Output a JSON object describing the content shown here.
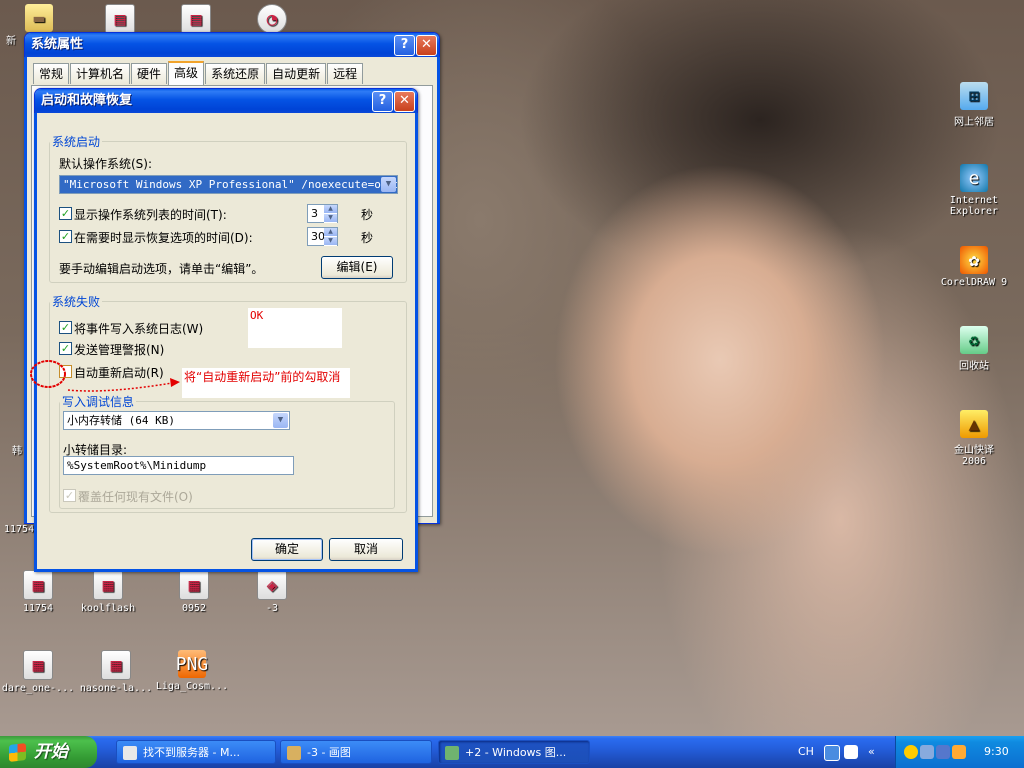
{
  "desktop_icons": [
    {
      "label": "新",
      "icon": "folder-icon"
    },
    {
      "label": "",
      "icon": "document-icon"
    },
    {
      "label": "",
      "icon": "document-icon"
    },
    {
      "label": "",
      "icon": "app-icon"
    },
    {
      "label": "网上邻居",
      "icon": "network-icon"
    },
    {
      "label": "Internet Explorer",
      "icon": "ie-icon"
    },
    {
      "label": "CorelDRAW 9",
      "icon": "corel-icon"
    },
    {
      "label": "回收站",
      "icon": "recycle-bin-icon"
    },
    {
      "label": "金山快译 2006",
      "icon": "kingsoft-icon"
    },
    {
      "label": "11754",
      "icon": "file-icon"
    },
    {
      "label": "koolflash",
      "icon": "file-icon"
    },
    {
      "label": "0952",
      "icon": "file-icon"
    },
    {
      "label": "-3",
      "icon": "image-icon"
    },
    {
      "label": "dare_one-...",
      "icon": "file-icon"
    },
    {
      "label": "nasone-la...",
      "icon": "file-icon"
    },
    {
      "label": "Liga_Cosm...",
      "icon": "png-icon"
    },
    {
      "label": "11754",
      "icon": "text-fragment"
    },
    {
      "label": "韩",
      "icon": "text-fragment"
    }
  ],
  "sysprops": {
    "title": "系统属性",
    "tabs": [
      "常规",
      "计算机名",
      "硬件",
      "高级",
      "系统还原",
      "自动更新",
      "远程"
    ],
    "active_tab": "高级"
  },
  "dialog": {
    "title": "启动和故障恢复",
    "startup": {
      "legend": "系统启动",
      "default_os_label": "默认操作系统(S):",
      "default_os_value": "\"Microsoft Windows XP Professional\" /noexecute=optin",
      "show_list_label": "显示操作系统列表的时间(T):",
      "show_list_value": "3",
      "show_recovery_label": "在需要时显示恢复选项的时间(D):",
      "show_recovery_value": "30",
      "seconds": "秒",
      "edit_hint": "要手动编辑启动选项，请单击“编辑”。",
      "edit_button": "编辑(E)"
    },
    "failure": {
      "legend": "系统失败",
      "write_log": "将事件写入系统日志(W)",
      "send_alert": "发送管理警报(N)",
      "auto_restart": "自动重新启动(R)",
      "debug_info_label": "写入调试信息",
      "dump_type": "小内存转储 (64 KB)",
      "dump_dir_label": "小转储目录:",
      "dump_dir_value": "%SystemRoot%\\Minidump",
      "overwrite": "覆盖任何现有文件(O)"
    },
    "ok_button": "确定",
    "cancel_button": "取消"
  },
  "annotations": {
    "ok_note": "OK",
    "uncheck_note": "将“自动重新启动”前的勾取消",
    "color": "#e30000"
  },
  "taskbar": {
    "start_label": "开始",
    "tasks": [
      "找不到服务器 - M...",
      "-3 - 画图",
      "+2 - Windows 图..."
    ],
    "lang": "CH",
    "clock": "9:30"
  },
  "colors": {
    "title_blue": "#0553e4",
    "window_bg": "#ece9d8",
    "legend_blue": "#0046d5",
    "start_green": "#3c9a3c"
  }
}
